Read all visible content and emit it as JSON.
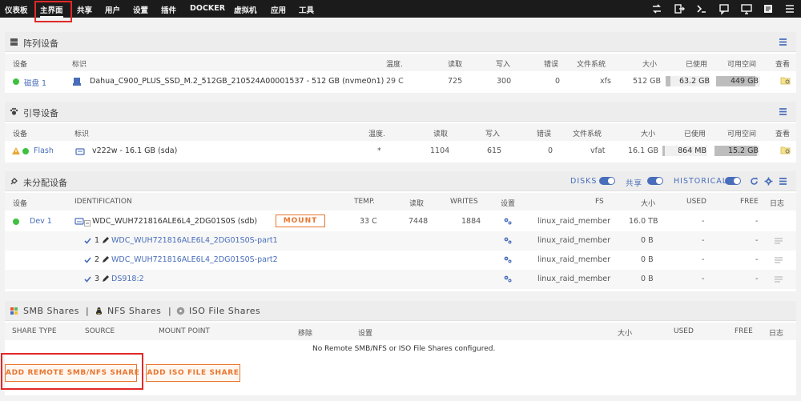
{
  "nav": {
    "items": [
      {
        "label": "仪表板"
      },
      {
        "label": "主界面"
      },
      {
        "label": "共享"
      },
      {
        "label": "用户"
      },
      {
        "label": "设置"
      },
      {
        "label": "插件"
      },
      {
        "label": "DOCKER"
      },
      {
        "label": "虚拟机"
      },
      {
        "label": "应用"
      },
      {
        "label": "工具"
      }
    ],
    "active": "主界面",
    "right_icons": [
      "swap-icon",
      "logout-icon",
      "terminal-icon",
      "feedback-icon",
      "monitor-icon",
      "info-icon",
      "menu-icon"
    ]
  },
  "array": {
    "title": "阵列设备",
    "headers": {
      "device": "设备",
      "identification": "标识",
      "temp": "温度.",
      "reads": "读取",
      "writes": "写入",
      "errors": "错误",
      "fs": "文件系统",
      "size": "大小",
      "used": "已使用",
      "free": "可用空间",
      "view": "查看"
    },
    "rows": [
      {
        "device": "磁盘 1",
        "identification": "Dahua_C900_PLUS_SSD_M.2_512GB_210524A00001537 - 512 GB (nvme0n1)",
        "temp": "29 C",
        "reads": "725",
        "writes": "300",
        "errors": "0",
        "fs": "xfs",
        "size": "512 GB",
        "used": "63.2 GB",
        "free": "449 GB",
        "used_fraction": 0.12,
        "free_fraction": 0.88
      }
    ]
  },
  "boot": {
    "title": "引导设备",
    "headers": {
      "device": "设备",
      "identification": "标识",
      "temp": "温度.",
      "reads": "读取",
      "writes": "写入",
      "errors": "错误",
      "fs": "文件系统",
      "size": "大小",
      "used": "已使用",
      "free": "可用空间",
      "view": "查看"
    },
    "rows": [
      {
        "device": "Flash",
        "identification": "v222w - 16.1 GB (sda)",
        "temp": "*",
        "reads": "1104",
        "writes": "615",
        "errors": "0",
        "fs": "vfat",
        "size": "16.1 GB",
        "used": "864 MB",
        "free": "15.2 GB",
        "used_fraction": 0.05,
        "free_fraction": 0.95
      }
    ]
  },
  "unassigned": {
    "title": "未分配设备",
    "toggles": {
      "disks": "DISKS",
      "shares": "共享",
      "historical": "HISTORICAL"
    },
    "headers": {
      "device": "设备",
      "identification": "IDENTIFICATION",
      "temp": "TEMP.",
      "reads": "读取",
      "writes": "WRITES",
      "settings": "设置",
      "fs": "FS",
      "size": "大小",
      "used": "USED",
      "free": "FREE",
      "log": "日志"
    },
    "disk": {
      "device": "Dev 1",
      "identification": "WDC_WUH721816ALE6L4_2DG01S0S (sdb)",
      "mount_label": "MOUNT",
      "temp": "33 C",
      "reads": "7448",
      "writes": "1884",
      "fs": "linux_raid_member",
      "size": "16.0 TB",
      "used": "-",
      "free": "-"
    },
    "partitions": [
      {
        "num": "1",
        "name": "WDC_WUH721816ALE6L4_2DG01S0S-part1",
        "fs": "linux_raid_member",
        "size": "0 B",
        "used": "-",
        "free": "-"
      },
      {
        "num": "2",
        "name": "WDC_WUH721816ALE6L4_2DG01S0S-part2",
        "fs": "linux_raid_member",
        "size": "0 B",
        "used": "-",
        "free": "-"
      },
      {
        "num": "3",
        "name": "DS918:2",
        "fs": "linux_raid_member",
        "size": "0 B",
        "used": "-",
        "free": "-"
      }
    ]
  },
  "shares": {
    "tabs": {
      "smb": "SMB Shares",
      "nfs": "NFS Shares",
      "iso": "ISO File Shares",
      "sep": "|"
    },
    "headers": {
      "share_type": "SHARE TYPE",
      "source": "SOURCE",
      "mount_point": "MOUNT POINT",
      "remove": "移除",
      "settings": "设置",
      "size": "大小",
      "used": "USED",
      "free": "FREE",
      "log": "日志"
    },
    "empty_message": "No Remote SMB/NFS or ISO File Shares configured.",
    "add_remote_label": "ADD REMOTE SMB/NFS SHARE",
    "add_iso_label": "ADD ISO FILE SHARE"
  },
  "colors": {
    "accent": "#486dba",
    "orange": "#e8752f",
    "green": "#3fc13f",
    "highlight": "#e22828",
    "topbar": "#1c1b1b"
  }
}
